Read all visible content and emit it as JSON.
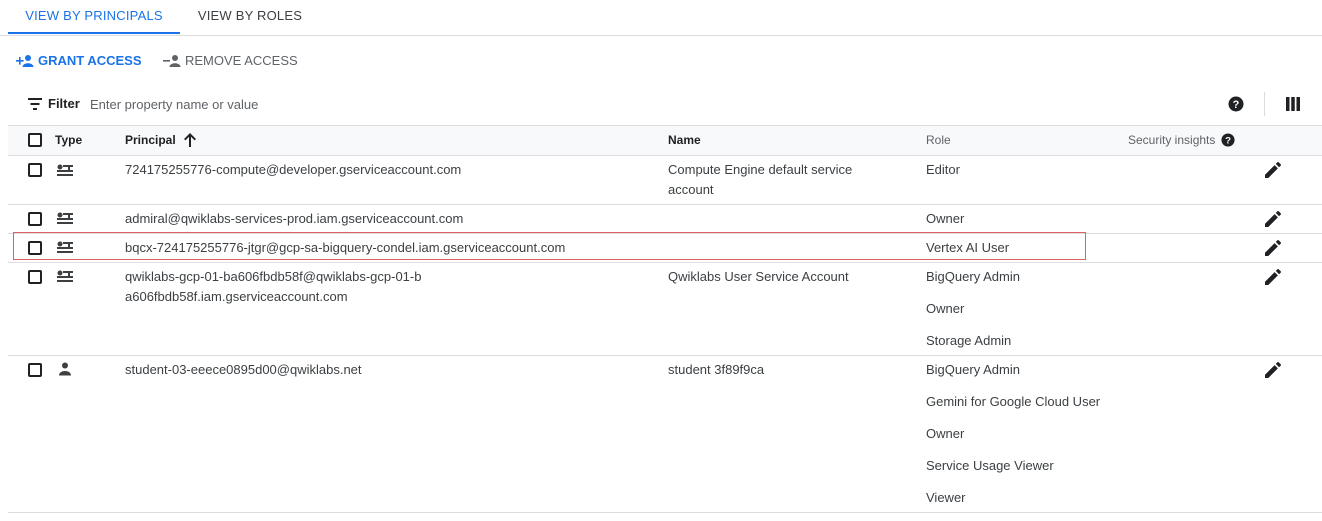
{
  "tabs": [
    {
      "label": "VIEW BY PRINCIPALS",
      "active": true
    },
    {
      "label": "VIEW BY ROLES",
      "active": false
    }
  ],
  "actions": {
    "grant_label": "GRANT ACCESS",
    "remove_label": "REMOVE ACCESS"
  },
  "filter": {
    "label": "Filter",
    "placeholder": "Enter property name or value"
  },
  "columns": {
    "type": "Type",
    "principal": "Principal",
    "name": "Name",
    "role": "Role",
    "security_insights": "Security insights"
  },
  "rows": [
    {
      "type": "service-account",
      "principal": "724175255776-compute@developer.gserviceaccount.com",
      "name": "Compute Engine default service account",
      "roles": [
        "Editor"
      ]
    },
    {
      "type": "service-account",
      "principal": "admiral@qwiklabs-services-prod.iam.gserviceaccount.com",
      "name": "",
      "roles": [
        "Owner"
      ]
    },
    {
      "type": "service-account",
      "principal": "bqcx-724175255776-jtgr@gcp-sa-bigquery-condel.iam.gserviceaccount.com",
      "name": "",
      "roles": [
        "Vertex AI User"
      ],
      "highlighted": true
    },
    {
      "type": "service-account",
      "principal": "qwiklabs-gcp-01-ba606fbdb58f@qwiklabs-gcp-01-ba606fbdb58f.iam.gserviceaccount.com",
      "name": "Qwiklabs User Service Account",
      "roles": [
        "BigQuery Admin",
        "Owner",
        "Storage Admin"
      ]
    },
    {
      "type": "user",
      "principal": "student-03-eeece0895d00@qwiklabs.net",
      "name": "student 3f89f9ca",
      "roles": [
        "BigQuery Admin",
        "Gemini for Google Cloud User",
        "Owner",
        "Service Usage Viewer",
        "Viewer"
      ]
    }
  ],
  "colors": {
    "accent": "#1a73e8",
    "highlight_border": "#e06060",
    "divider": "#dadce0"
  }
}
